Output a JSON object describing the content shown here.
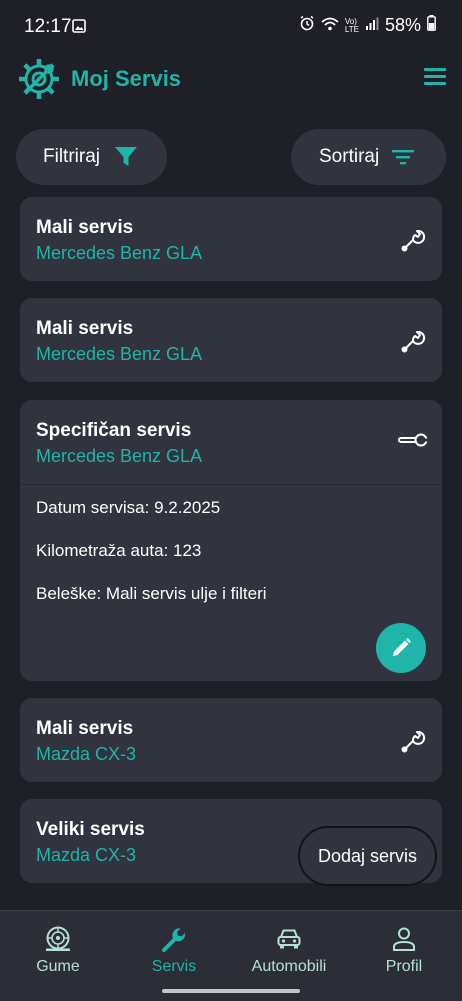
{
  "status_bar": {
    "time": "12:17",
    "battery": "58%",
    "network": "LTE"
  },
  "app_bar": {
    "title": "Moj Servis",
    "logo_icon": "gear-wrench-icon",
    "menu_icon": "hamburger-menu-icon"
  },
  "toolbar": {
    "filter_label": "Filtriraj",
    "filter_icon": "filter-icon",
    "sort_label": "Sortiraj",
    "sort_icon": "sort-icon"
  },
  "services": [
    {
      "title": "Mali servis",
      "car": "Mercedes Benz GLA",
      "expanded": false
    },
    {
      "title": "Mali servis",
      "car": "Mercedes Benz GLA",
      "expanded": false
    },
    {
      "title": "Specifičan servis",
      "car": "Mercedes Benz GLA",
      "expanded": true,
      "date_line": "Datum servisa: 9.2.2025",
      "km_line": "Kilometraža auta: 123",
      "notes_line": "Beleške: Mali servis ulje i filteri"
    },
    {
      "title": "Mali servis",
      "car": "Mazda CX-3",
      "expanded": false
    },
    {
      "title": "Veliki servis",
      "car": "Mazda CX-3",
      "expanded": false
    }
  ],
  "add_button": {
    "label": "Dodaj servis"
  },
  "bottom_nav": [
    {
      "label": "Gume",
      "icon": "tire-icon",
      "active": false
    },
    {
      "label": "Servis",
      "icon": "wrench-icon",
      "active": true
    },
    {
      "label": "Automobili",
      "icon": "car-icon",
      "active": false
    },
    {
      "label": "Profil",
      "icon": "person-icon",
      "active": false
    }
  ],
  "colors": {
    "background": "#1e1f27",
    "card": "#31333f",
    "accent": "#1fb5a8",
    "text": "#ffffff"
  }
}
